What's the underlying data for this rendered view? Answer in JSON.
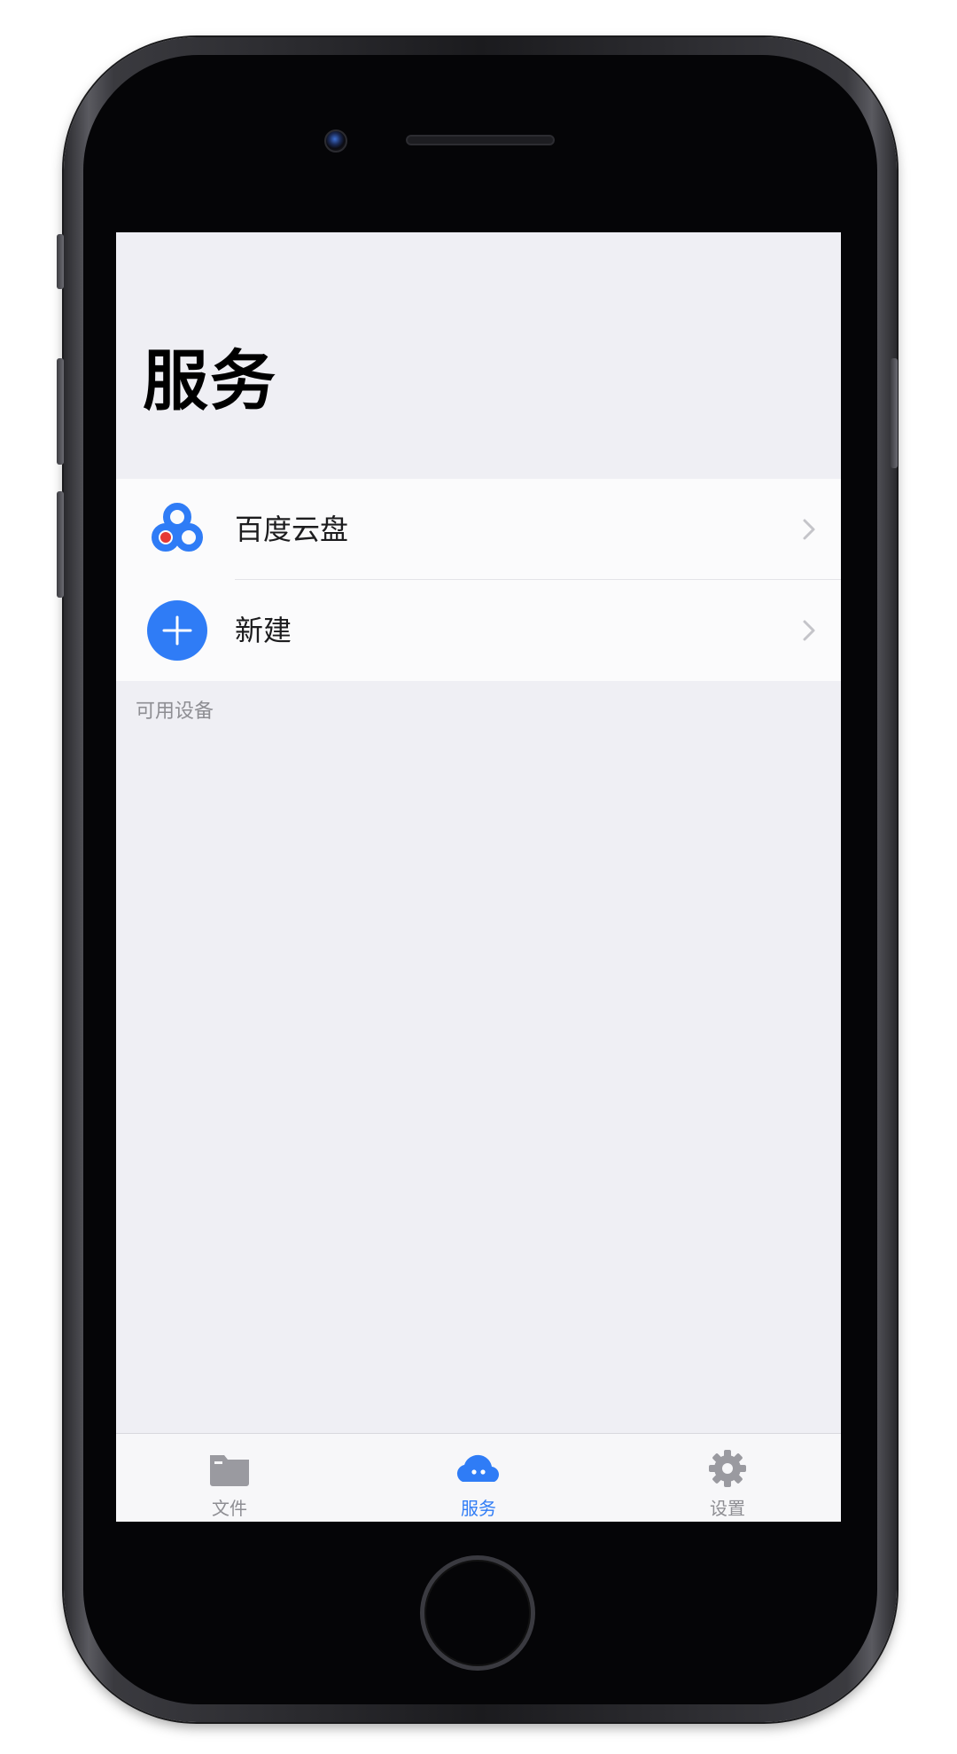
{
  "page": {
    "title": "服务"
  },
  "services": [
    {
      "label": "百度云盘",
      "icon": "baidu-cloud-icon"
    },
    {
      "label": "新建",
      "icon": "plus-circle-icon"
    }
  ],
  "section_footer": "可用设备",
  "tabbar": {
    "tabs": [
      {
        "label": "文件",
        "icon": "folder-icon",
        "active": false
      },
      {
        "label": "服务",
        "icon": "cloud-icon",
        "active": true
      },
      {
        "label": "设置",
        "icon": "gear-icon",
        "active": false
      }
    ]
  },
  "colors": {
    "accent": "#2f7cf6",
    "inactive": "#8e8e93",
    "background": "#efeff4",
    "baidu_red": "#e53935"
  }
}
